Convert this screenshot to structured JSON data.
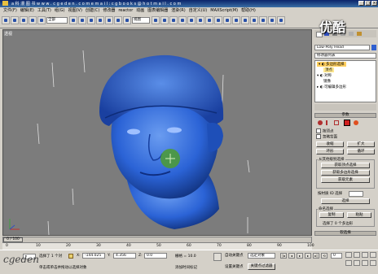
{
  "window": {
    "title": "a 科 漫 图 书     w w w . c g e d e n . c o m     e m a i l : c g b o o k s @ h o t m a i l . c o m"
  },
  "menu": [
    "文件(F)",
    "编辑(E)",
    "工具(T)",
    "组(G)",
    "视图(V)",
    "创建(C)",
    "修改器",
    "reactor",
    "动画",
    "图表编辑器",
    "渲染(R)",
    "自定义(U)",
    "MAXScript(M)",
    "帮助(H)"
  ],
  "toolbar": {
    "selection_filter": "全部",
    "ref_coord": "视图"
  },
  "viewport": {
    "label": "透视",
    "axis": "x"
  },
  "panel": {
    "object_name": "Low-Poly Head",
    "modifier_list": "修改器列表",
    "stack": [
      "多边形选择",
      "顶点",
      "对称",
      "镜像",
      "可编辑多边形"
    ],
    "rollouts": {
      "params": "参数",
      "falloff": "软选择",
      "soft_select": "选择",
      "extra": "附加选择"
    },
    "checks": {
      "by_vertex": "按顶点",
      "ignore_back": "忽略背面"
    },
    "buttons": {
      "shrink": "收缩",
      "grow": "扩大",
      "ring": "环形",
      "loop": "循环",
      "get_vertex": "获取顶点选择",
      "get_poly": "获取多边形选择",
      "get_element": "获取元素",
      "copy": "复制",
      "paste": "粘贴",
      "select_by_id": "按材质 ID 选择",
      "named_sel": "命名选择",
      "select": "选择"
    },
    "get_stack_label": "从其他级别选择",
    "id_label": "按材质 ID 选择",
    "status": "选择了 0 个多边形"
  },
  "timeline": {
    "frame": "0 / 100"
  },
  "ruler": [
    "0",
    "10",
    "20",
    "30",
    "40",
    "50",
    "60",
    "70",
    "80",
    "90",
    "100"
  ],
  "status": {
    "selected": "选择了 1 个对",
    "x_label": "X:",
    "x": "-144.025",
    "y_label": "Y:",
    "y": "4.356",
    "z_label": "Z:",
    "z": "0.0",
    "grid": "栅格 = 10.0",
    "auto_key": "自动关键点",
    "set_key": "设置关键点",
    "selected_filter": "选定对象",
    "key_filter": "关键点过滤器",
    "add_time_tag": "添加时间标记",
    "hint": "单击或单击并拖动以选择对象",
    "frame": "0",
    "script_label": "欢迎使用"
  },
  "watermark": {
    "site": "cgeden",
    "logo": "优酷"
  }
}
